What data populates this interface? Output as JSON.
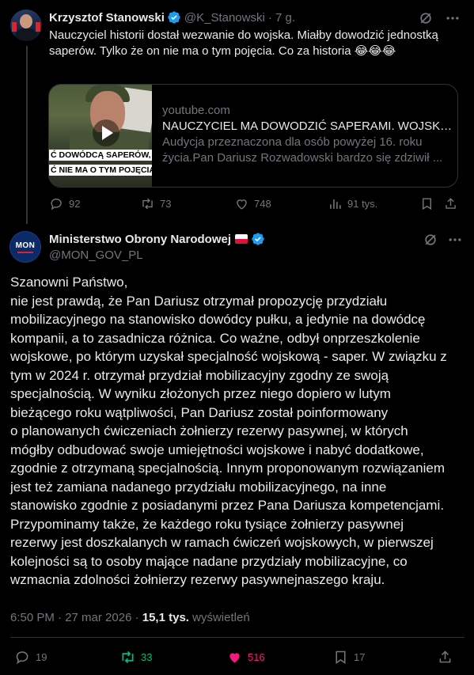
{
  "parent_tweet": {
    "author_name": "Krzysztof Stanowski",
    "handle": "@K_Stanowski",
    "time": "· 7 g.",
    "text": "Nauczyciel historii dostał wezwanie do wojska. Miałby dowodzić jednostką saperów. Tylko że on nie ma o tym pojęcia. Co za historia 😂😂😂",
    "card": {
      "domain": "youtube.com",
      "title": "NAUCZYCIEL MA DOWODZIĆ SAPERAMI. WOJSKO...",
      "description": "Audycja przeznaczona dla osób powyżej 16. roku życia.Pan Dariusz Rozwadowski bardzo się zdziwił ...",
      "thumb_caption_1": "Ć DOWÓDCĄ SAPERÓW,",
      "thumb_caption_2": "Ć NIE MA O TYM POJĘCIA"
    },
    "stats": {
      "replies": "92",
      "reposts": "73",
      "likes": "748",
      "views": "91 tys."
    }
  },
  "main_tweet": {
    "avatar_text": "MON",
    "author_name": "Ministerstwo Obrony Narodowej",
    "handle": "@MON_GOV_PL",
    "body_lines": [
      "Szanowni Państwo,",
      "nie jest prawdą, że Pan Dariusz otrzymał propozycję przydziału",
      "mobilizacyjnego na stanowisko dowódcy pułku, a jedynie na dowódcę",
      "kompanii, a to zasadnicza różnica. Co ważne, odbył onprzeszkolenie",
      "wojskowe, po którym uzyskał specjalność wojskową - saper. W związku z",
      "tym w 2024 r. otrzymał przydział mobilizacyjny zgodny ze swoją",
      "specjalnością. W wyniku złożonych  przez niego dopiero w lutym",
      "bieżącego roku wątpliwości, Pan Dariusz został poinformowany",
      "o planowanych ćwiczeniach żołnierzy rezerwy pasywnej, w których",
      "mógłby odbudować swoje umiejętności wojskowe i nabyć dodatkowe,",
      "zgodnie z otrzymaną specjalnością. Innym proponowanym rozwiązaniem",
      "jest też zamiana nadanego przydziału mobilizacyjnego, na inne",
      "stanowisko zgodnie z posiadanymi przez Pana Dariusza kompetencjami.",
      "Przypominamy także, że każdego roku tysiące żołnierzy pasywnej",
      "rezerwy jest doszkalanych w ramach ćwiczeń wojskowych, w pierwszej",
      "kolejności są to osoby mające nadane przydziały mobilizacyjne, co",
      "wzmacnia zdolności żołnierzy rezerwy pasywnejnaszego kraju."
    ],
    "timestamp": "6:50 PM · 27 mar 2026 ·",
    "views_count": "15,1 tys.",
    "views_label": "wyświetleń",
    "stats": {
      "replies": "19",
      "reposts": "33",
      "likes": "516",
      "bookmarks": "17"
    }
  },
  "colors": {
    "background": "#000000",
    "text": "#e7e9ea",
    "muted": "#71767b",
    "verified": "#1d9bf0",
    "repost_active": "#00ba7c",
    "like_active": "#f91880",
    "border": "#2f3336"
  },
  "icons": [
    "verified-badge-icon",
    "grok-icon",
    "more-icon",
    "reply-icon",
    "repost-icon",
    "like-icon",
    "views-icon",
    "bookmark-icon",
    "share-icon",
    "play-icon",
    "poland-flag-icon"
  ]
}
